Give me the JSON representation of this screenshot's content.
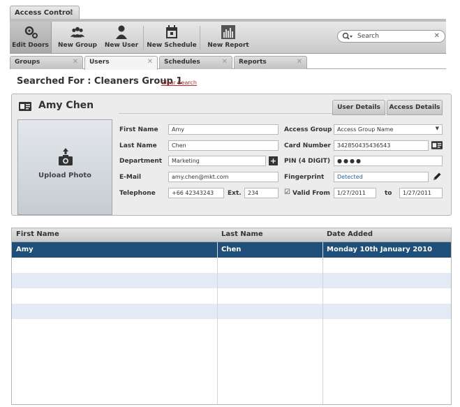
{
  "window": {
    "tab_label": "Access Control",
    "close": "✕"
  },
  "toolbar": {
    "buttons": [
      {
        "label": "Edit Doors",
        "icon": "gears-icon"
      },
      {
        "label": "New Group",
        "icon": "group-icon"
      },
      {
        "label": "New User",
        "icon": "user-icon"
      },
      {
        "label": "New Schedule",
        "icon": "schedule-icon"
      },
      {
        "label": "New Report",
        "icon": "report-icon"
      }
    ],
    "search_placeholder": "Search",
    "search_clear": "✕"
  },
  "tabs": [
    {
      "label": "Groups",
      "close": "✕"
    },
    {
      "label": "Users",
      "close": "✕"
    },
    {
      "label": "Schedules",
      "close": "✕"
    },
    {
      "label": "Reports",
      "close": "✕"
    }
  ],
  "search_result": {
    "text": "Searched For : Cleaners Group 1",
    "clear_link": "Clear Search"
  },
  "user": {
    "name": "Amy Chen",
    "detail_tabs": [
      "User Details",
      "Access Details"
    ],
    "upload_photo": "Upload Photo",
    "fields": {
      "first_name": {
        "label": "First Name",
        "value": "Amy"
      },
      "last_name": {
        "label": "Last Name",
        "value": "Chen"
      },
      "department": {
        "label": "Department",
        "value": "Marketing"
      },
      "email": {
        "label": "E-Mail",
        "value": "amy.chen@mkt.com"
      },
      "telephone": {
        "label": "Telephone",
        "value": "+66 42343243"
      },
      "ext": {
        "label": "Ext.",
        "value": "234"
      },
      "access_group": {
        "label": "Access Group",
        "value": "Access Group Name"
      },
      "card_number": {
        "label": "Card Number",
        "value": "342850435436543"
      },
      "pin": {
        "label": "PIN (4 DIGIT)",
        "value": "●●●●"
      },
      "fingerprint": {
        "label": "Fingerprint",
        "value": "Detected"
      },
      "valid_from": {
        "label": "Valid From",
        "value": "1/27/2011",
        "to_label": "to",
        "to_value": "1/27/2011",
        "checkbox": "☑"
      }
    },
    "dept_add": "+"
  },
  "table": {
    "columns": [
      "First Name",
      "Last Name",
      "Date Added"
    ],
    "rows": [
      {
        "first": "Amy",
        "last": "Chen",
        "date": "Monday 10th January 2010"
      }
    ]
  },
  "colors": {
    "selected_row": "#1e4f7a",
    "alt_row": "#e3e9f5",
    "link_red": "#c0282d"
  }
}
